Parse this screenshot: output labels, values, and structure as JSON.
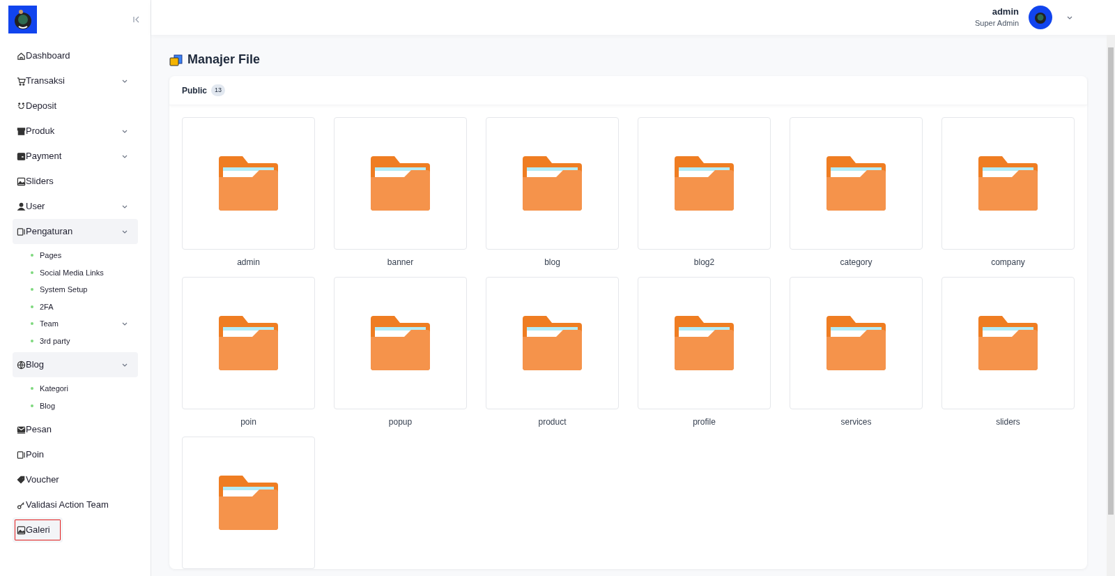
{
  "sidebar": {
    "items": [
      {
        "label": "Dashboard",
        "kind": "link",
        "selected": false
      },
      {
        "label": "Transaksi",
        "kind": "menu",
        "expanded": false,
        "selected": false
      },
      {
        "label": "Deposit",
        "kind": "link",
        "selected": false
      },
      {
        "label": "Produk",
        "kind": "menu",
        "expanded": false,
        "selected": false
      },
      {
        "label": "Payment",
        "kind": "menu",
        "expanded": false,
        "selected": false
      },
      {
        "label": "Sliders",
        "kind": "link",
        "selected": false
      },
      {
        "label": "User",
        "kind": "menu",
        "expanded": false,
        "selected": false
      },
      {
        "label": "Pengaturan",
        "kind": "menu",
        "expanded": true,
        "selected": false,
        "children": [
          {
            "label": "Pages",
            "kind": "link"
          },
          {
            "label": "Social Media Links",
            "kind": "link"
          },
          {
            "label": "System Setup",
            "kind": "link"
          },
          {
            "label": "2FA",
            "kind": "link"
          },
          {
            "label": "Team",
            "kind": "menu"
          },
          {
            "label": "3rd party",
            "kind": "link"
          }
        ]
      },
      {
        "label": "Blog",
        "kind": "menu",
        "expanded": true,
        "selected": false,
        "children": [
          {
            "label": "Kategori",
            "kind": "link"
          },
          {
            "label": "Blog",
            "kind": "link"
          }
        ]
      },
      {
        "label": "Pesan",
        "kind": "link",
        "selected": false
      },
      {
        "label": "Poin",
        "kind": "link",
        "selected": false
      },
      {
        "label": "Voucher",
        "kind": "link",
        "selected": false
      },
      {
        "label": "Validasi Action Team",
        "kind": "link",
        "selected": false
      },
      {
        "label": "Galeri",
        "kind": "link",
        "selected": true
      }
    ]
  },
  "header": {
    "user_name": "admin",
    "user_role": "Super Admin"
  },
  "page_title": "Manajer File",
  "tabs": [
    {
      "label": "Public",
      "count": "13",
      "selected": true
    }
  ],
  "folders": [
    {
      "kind": "folder",
      "name": "admin"
    },
    {
      "kind": "folder",
      "name": "banner"
    },
    {
      "kind": "folder",
      "name": "blog"
    },
    {
      "kind": "folder",
      "name": "blog2"
    },
    {
      "kind": "folder",
      "name": "category"
    },
    {
      "kind": "folder",
      "name": "company"
    },
    {
      "kind": "folder",
      "name": "poin"
    },
    {
      "kind": "folder",
      "name": "popup"
    },
    {
      "kind": "folder",
      "name": "product"
    },
    {
      "kind": "folder",
      "name": "profile"
    },
    {
      "kind": "folder",
      "name": "services"
    },
    {
      "kind": "folder",
      "name": "sliders"
    },
    {
      "kind": "folder"
    }
  ]
}
